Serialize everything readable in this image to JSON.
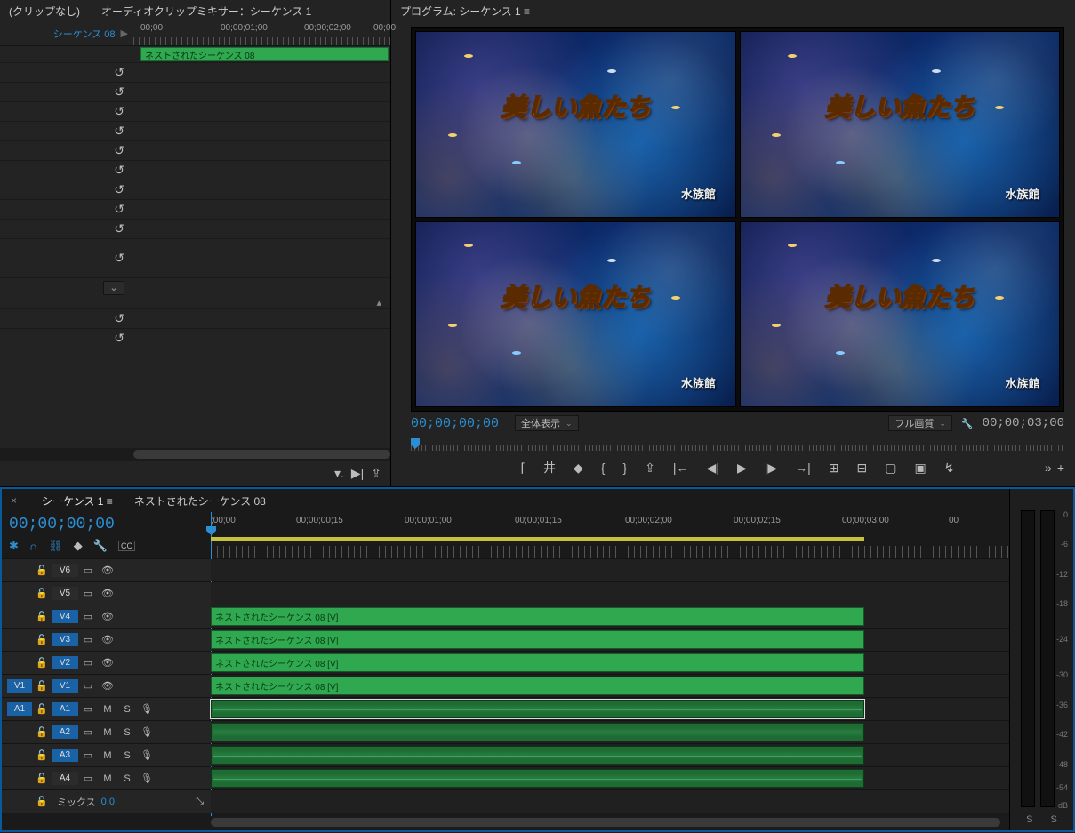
{
  "tl_tabs": {
    "left": "(クリップなし)",
    "right": "オーディオクリップミキサー：シーケンス 1"
  },
  "tl_seq_label": "シーケンス 08",
  "tl_clip_name": "ネストされたシーケンス 08",
  "tl_ruler": [
    "00;00",
    "00;00;01;00",
    "00;00;02;00",
    "00;00;"
  ],
  "program_tab": "プログラム: シーケンス 1  ≡",
  "preview_title": "美しい魚たち",
  "preview_sub": "水族館",
  "prog_tc_left": "00;00;00;00",
  "prog_tc_right": "00;00;03;00",
  "zoom_select": "全体表示",
  "res_select": "フル画質",
  "timeline_tabs": {
    "active": "シーケンス 1  ≡",
    "other": "ネストされたシーケンス 08"
  },
  "timeline_tc": "00;00;00;00",
  "timeline_ruler": [
    ";00;00",
    "00;00;00;15",
    "00;00;01;00",
    "00;00;01;15",
    "00;00;02;00",
    "00;00;02;15",
    "00;00;03;00",
    "00"
  ],
  "video_tracks": [
    {
      "src": "",
      "label": "V6",
      "on": false
    },
    {
      "src": "",
      "label": "V5",
      "on": false
    },
    {
      "src": "",
      "label": "V4",
      "on": true,
      "clip": "ネストされたシーケンス 08 [V]"
    },
    {
      "src": "",
      "label": "V3",
      "on": true,
      "clip": "ネストされたシーケンス 08 [V]"
    },
    {
      "src": "",
      "label": "V2",
      "on": true,
      "clip": "ネストされたシーケンス 08 [V]"
    },
    {
      "src": "V1",
      "label": "V1",
      "on": true,
      "clip": "ネストされたシーケンス 08 [V]"
    }
  ],
  "audio_tracks": [
    {
      "src": "A1",
      "label": "A1",
      "on": true,
      "sel": true
    },
    {
      "src": "",
      "label": "A2",
      "on": true
    },
    {
      "src": "",
      "label": "A3",
      "on": true
    },
    {
      "src": "",
      "label": "A4",
      "on": false
    }
  ],
  "mix_label": "ミックス",
  "mix_value": "0.0",
  "ms": {
    "m": "M",
    "s": "S"
  },
  "meter_ticks": [
    "0",
    "-6",
    "-12",
    "-18",
    "-24",
    "-30",
    "-36",
    "-42",
    "-48",
    "-54",
    "dB"
  ],
  "meter_foot": {
    "l": "S",
    "r": "S"
  }
}
